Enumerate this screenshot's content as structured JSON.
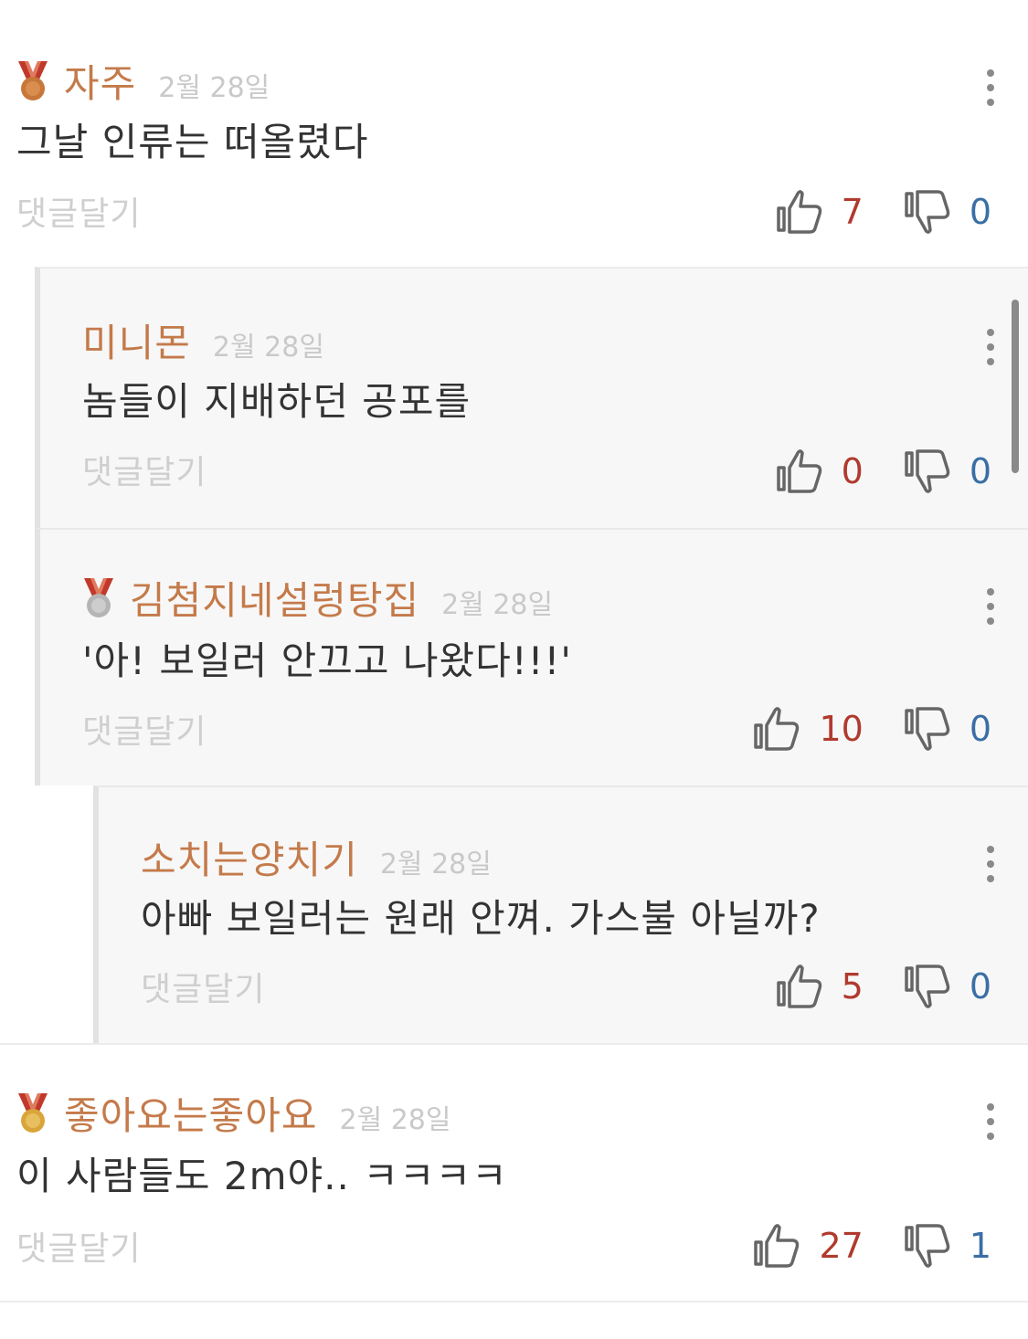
{
  "comments": [
    {
      "author": "자주",
      "date": "2월 28일",
      "text": "그날 인류는 떠올렸다",
      "reply": "댓글달기",
      "likes": "7",
      "dislikes": "0",
      "medal": "bronze"
    },
    {
      "author": "미니몬",
      "date": "2월 28일",
      "text": "놈들이 지배하던 공포를",
      "reply": "댓글달기",
      "likes": "0",
      "dislikes": "0"
    },
    {
      "author": "김첨지네설렁탕집",
      "date": "2월 28일",
      "text": "'아! 보일러 안끄고 나왔다!!!'",
      "reply": "댓글달기",
      "likes": "10",
      "dislikes": "0",
      "medal": "silver"
    },
    {
      "author": "소치는양치기",
      "date": "2월 28일",
      "text": "아빠 보일러는 원래 안껴. 가스불 아닐까?",
      "reply": "댓글달기",
      "likes": "5",
      "dislikes": "0"
    },
    {
      "author": "좋아요는좋아요",
      "date": "2월 28일",
      "text": "이 사람들도 2m야.. ㅋㅋㅋㅋ",
      "reply": "댓글달기",
      "likes": "27",
      "dislikes": "1",
      "medal": "gold"
    }
  ],
  "colors": {
    "author": "#c47a4a",
    "likes": "#b03a2e",
    "dislikes": "#3a6ea5",
    "bronze": "#c8773a",
    "silver": "#b5b5b5",
    "gold": "#d9a53a",
    "ribbon": "#c0392b"
  },
  "icons": {
    "like": "thumbs-up-icon",
    "dislike": "thumbs-down-icon",
    "more": "more-vertical-icon",
    "medal": "medal-icon"
  }
}
